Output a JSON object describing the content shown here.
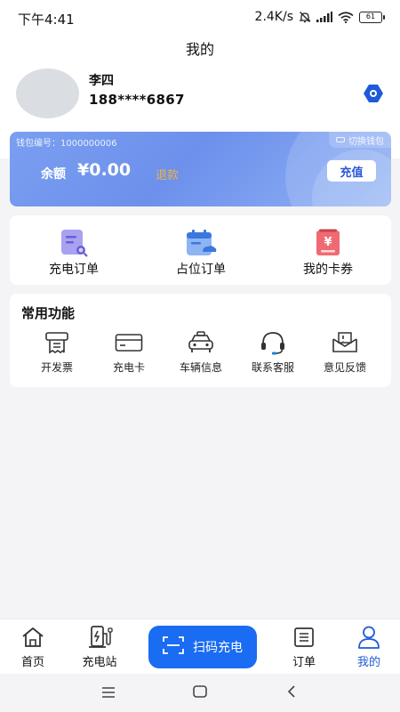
{
  "status_bar": {
    "time": "下午4:41",
    "speed": "2.4K/s",
    "battery": "61"
  },
  "page": {
    "title": "我的"
  },
  "profile": {
    "name": "李四",
    "phone": "188****6867"
  },
  "wallet": {
    "number_label": "钱包编号：1000000006",
    "switch_label": "切换钱包",
    "balance_label": "余额",
    "balance_value": "¥0.00",
    "refund_label": "退款",
    "recharge_label": "充值"
  },
  "orders": [
    {
      "label": "充电订单",
      "icon": "charge-order-icon"
    },
    {
      "label": "占位订单",
      "icon": "parking-order-icon"
    },
    {
      "label": "我的卡券",
      "icon": "coupon-icon"
    }
  ],
  "common": {
    "title": "常用功能",
    "items": [
      {
        "label": "开发票",
        "icon": "invoice-icon"
      },
      {
        "label": "充电卡",
        "icon": "charge-card-icon"
      },
      {
        "label": "车辆信息",
        "icon": "car-icon"
      },
      {
        "label": "联系客服",
        "icon": "headset-icon"
      },
      {
        "label": "意见反馈",
        "icon": "feedback-icon"
      }
    ]
  },
  "nav": {
    "home": "首页",
    "stations": "充电站",
    "scan": "扫码充电",
    "orders": "订单",
    "mine": "我的"
  },
  "colors": {
    "accent": "#1f5ad8",
    "scan_button": "#1a6cf2",
    "refund": "#e9b34a"
  }
}
